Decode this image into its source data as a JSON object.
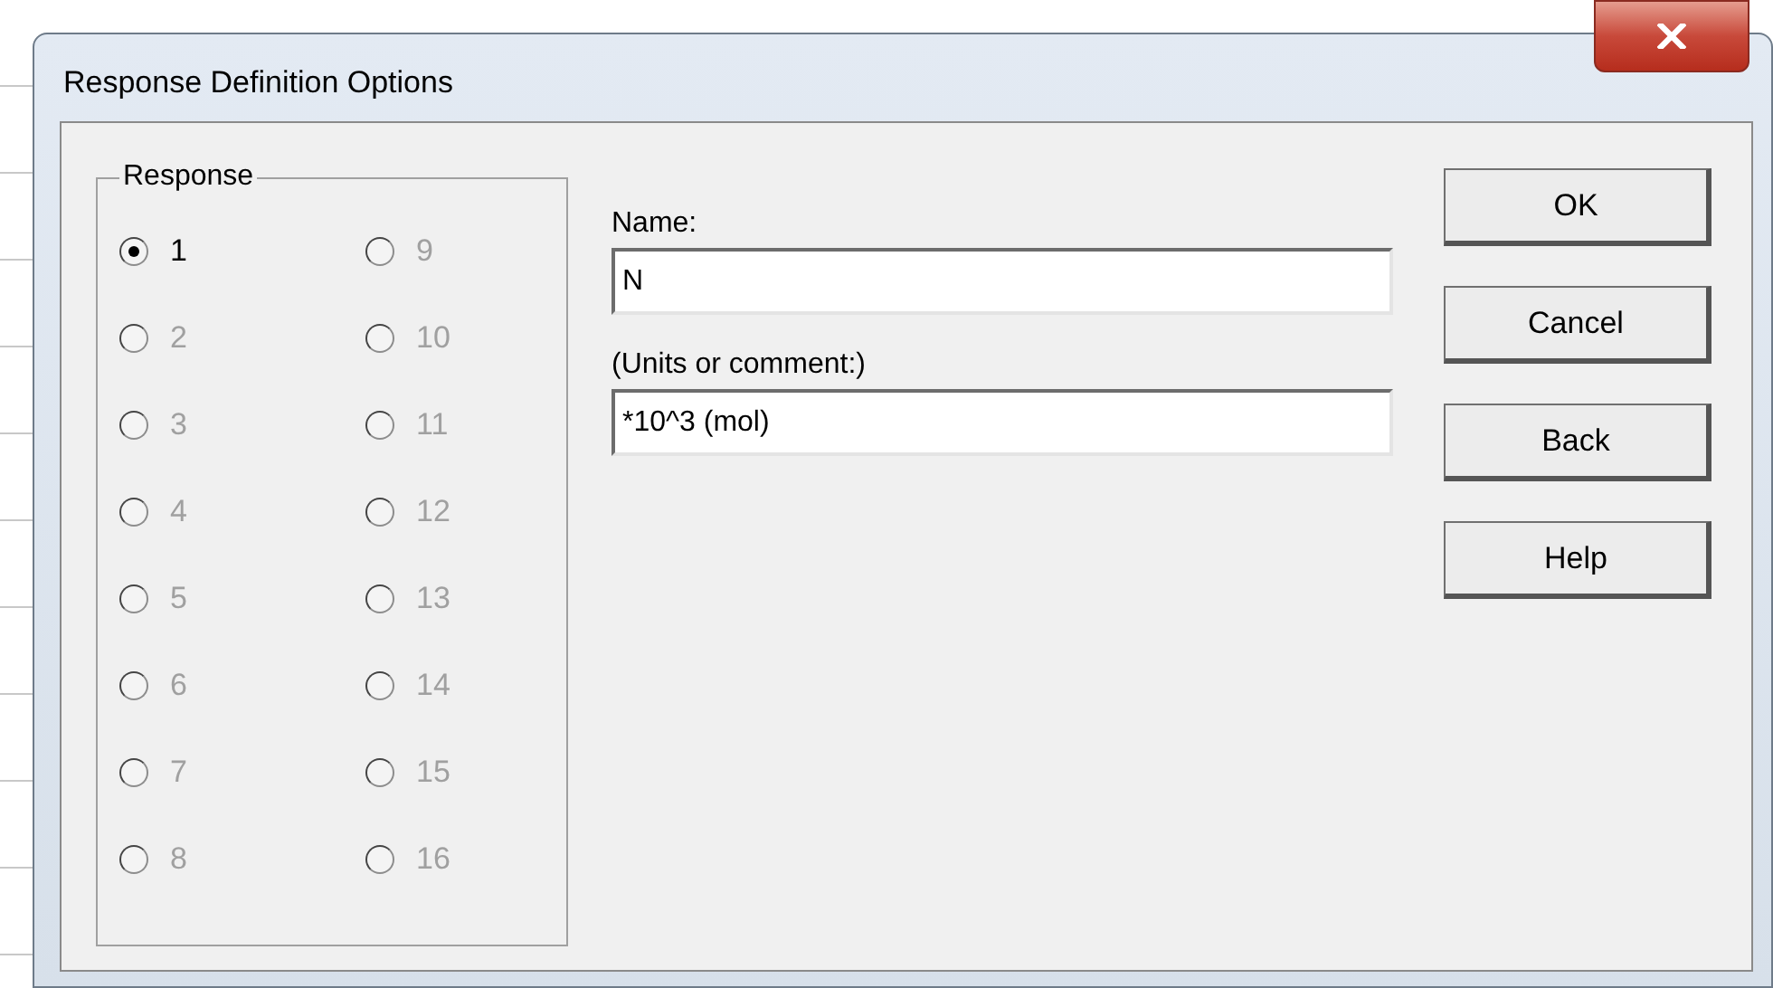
{
  "window": {
    "title": "Response Definition Options"
  },
  "response_group": {
    "label": "Response",
    "options": [
      {
        "label": "1",
        "selected": true,
        "disabled": false
      },
      {
        "label": "2",
        "selected": false,
        "disabled": true
      },
      {
        "label": "3",
        "selected": false,
        "disabled": true
      },
      {
        "label": "4",
        "selected": false,
        "disabled": true
      },
      {
        "label": "5",
        "selected": false,
        "disabled": true
      },
      {
        "label": "6",
        "selected": false,
        "disabled": true
      },
      {
        "label": "7",
        "selected": false,
        "disabled": true
      },
      {
        "label": "8",
        "selected": false,
        "disabled": true
      },
      {
        "label": "9",
        "selected": false,
        "disabled": true
      },
      {
        "label": "10",
        "selected": false,
        "disabled": true
      },
      {
        "label": "11",
        "selected": false,
        "disabled": true
      },
      {
        "label": "12",
        "selected": false,
        "disabled": true
      },
      {
        "label": "13",
        "selected": false,
        "disabled": true
      },
      {
        "label": "14",
        "selected": false,
        "disabled": true
      },
      {
        "label": "15",
        "selected": false,
        "disabled": true
      },
      {
        "label": "16",
        "selected": false,
        "disabled": true
      }
    ]
  },
  "fields": [
    {
      "label": "Name:",
      "value": "N"
    },
    {
      "label": "(Units or comment:)",
      "value": "*10^3 (mol)"
    }
  ],
  "buttons": [
    "OK",
    "Cancel",
    "Back",
    "Help"
  ]
}
